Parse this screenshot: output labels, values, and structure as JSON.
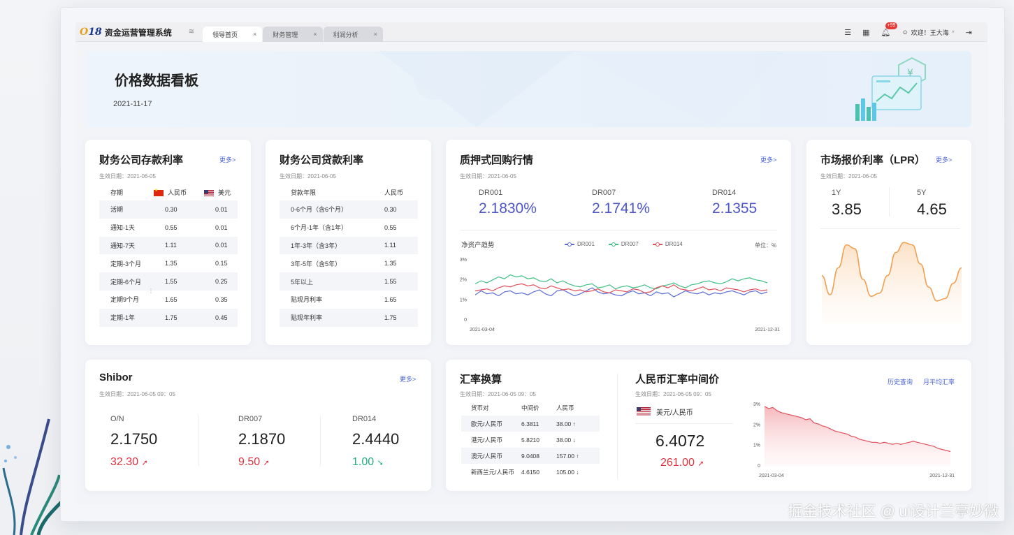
{
  "app": {
    "logo_mark": "18",
    "title": "资金运营管理系统",
    "tabs": [
      {
        "label": "领导首页",
        "close": "×"
      },
      {
        "label": "财务管理",
        "close": "×"
      },
      {
        "label": "利润分析",
        "close": "×"
      }
    ],
    "notification_badge": "+99",
    "welcome": "欢迎！王大海",
    "user_caret": "˅"
  },
  "banner": {
    "title": "价格数据看板",
    "date": "2021-11-17"
  },
  "deposit": {
    "title": "财务公司存款利率",
    "more": "更多>",
    "effective": "生效日期：2021-06-05",
    "headers": [
      "存期",
      "人民币",
      "美元"
    ],
    "rows": [
      [
        "活期",
        "0.30",
        "0.01"
      ],
      [
        "通知-1天",
        "0.55",
        "0.01"
      ],
      [
        "通知-7天",
        "1.11",
        "0.01"
      ],
      [
        "定期-3个月",
        "1.35",
        "0.15"
      ],
      [
        "定期-6个月",
        "1.55",
        "0.25"
      ],
      [
        "定期9个月",
        "1.65",
        "0.35"
      ],
      [
        "定期-1年",
        "1.75",
        "0.45"
      ]
    ]
  },
  "loan": {
    "title": "财务公司贷款利率",
    "effective": "生效日期：2021-06-05",
    "headers": [
      "贷款年限",
      "人民币"
    ],
    "rows": [
      [
        "0-6个月（含6个月）",
        "0.30"
      ],
      [
        "6个月-1年（含1年）",
        "0.55"
      ],
      [
        "1年-3年（含3年）",
        "1.11"
      ],
      [
        "3年-5年（含5年）",
        "1.35"
      ],
      [
        "5年以上",
        "1.55"
      ],
      [
        "贴现月利率",
        "1.65"
      ],
      [
        "贴现年利率",
        "1.75"
      ]
    ]
  },
  "repo": {
    "title": "质押式回购行情",
    "more": "更多>",
    "effective": "生效日期：2021-06-05",
    "items": [
      {
        "label": "DR001",
        "value": "2.1830%"
      },
      {
        "label": "DR007",
        "value": "2.1741%"
      },
      {
        "label": "DR014",
        "value": "2.1355"
      }
    ],
    "chart_title": "净资产趋势",
    "unit": "单位：%"
  },
  "lpr": {
    "title": "市场报价利率（LPR）",
    "more": "更多>",
    "effective": "生效日期：2021-06-05",
    "items": [
      {
        "label": "1Y",
        "value": "3.85"
      },
      {
        "label": "5Y",
        "value": "4.65"
      }
    ]
  },
  "shibor": {
    "title": "Shibor",
    "more": "更多>",
    "effective": "生效日期：2021-06-05  09：05",
    "items": [
      {
        "label": "O/N",
        "value": "2.1750",
        "change": "32.30",
        "arrow": "➚"
      },
      {
        "label": "DR007",
        "value": "2.1870",
        "change": "9.50",
        "arrow": "➚"
      },
      {
        "label": "DR014",
        "value": "2.4440",
        "change": "1.00",
        "arrow": "➘"
      }
    ]
  },
  "fx": {
    "title": "汇率换算",
    "effective": "生效日期：2021-06-05  09：05",
    "headers": [
      "货币对",
      "中间价",
      "人民币"
    ],
    "rows": [
      [
        "欧元/人民币",
        "6.3811",
        "38.00 ↑"
      ],
      [
        "港元/人民币",
        "5.8210",
        "38.00 ↓"
      ],
      [
        "澳元/人民币",
        "9.0408",
        "157.00 ↑"
      ],
      [
        "新西兰元/人民币",
        "4.6150",
        "105.00 ↓"
      ]
    ]
  },
  "cny_mid": {
    "title": "人民币汇率中间价",
    "effective": "生效日期：2021-06-05  09：05",
    "history_link": "历史查询",
    "avg_link": "月平均汇率",
    "pair": "美元/人民币",
    "value": "6.4072",
    "change": "261.00",
    "arrow": "➚"
  },
  "watermark": "掘金技术社区 @ ui设计兰亭妙微",
  "colors": {
    "accent": "#4d55c9",
    "up": "#e0323e",
    "down": "#23b07d",
    "link": "#4a64d8"
  },
  "chart_data": [
    {
      "type": "line",
      "title": "净资产趋势",
      "ylabel": "单位：%",
      "ylim": [
        0,
        3
      ],
      "yticks": [
        "3%",
        "2%",
        "1%",
        "0"
      ],
      "x_start": "2021-03-04",
      "x_end": "2021-12-31",
      "series": [
        {
          "name": "DR001",
          "color": "#5b6ad8",
          "values": [
            1.25,
            1.45,
            1.3,
            1.35,
            1.2,
            1.4,
            1.45,
            1.3,
            1.35,
            1.25,
            1.4,
            1.5,
            1.3,
            1.2,
            1.45,
            1.5,
            1.35,
            1.2,
            1.3,
            1.45,
            1.6,
            1.4,
            1.3,
            1.35,
            1.25,
            1.2,
            1.35,
            1.45,
            1.3,
            1.35,
            1.2,
            1.4,
            1.3,
            1.35,
            1.15,
            1.3,
            1.45,
            1.35,
            1.3,
            1.4,
            1.25,
            1.35,
            1.3,
            1.4,
            1.45,
            1.35,
            1.25,
            1.4,
            1.45,
            1.3,
            1.4
          ]
        },
        {
          "name": "DR007",
          "color": "#3fbf83",
          "values": [
            1.8,
            1.95,
            1.85,
            2.0,
            2.15,
            2.05,
            2.25,
            2.15,
            2.2,
            2.05,
            2.1,
            1.95,
            1.9,
            2.05,
            1.85,
            1.95,
            1.8,
            1.7,
            1.65,
            1.75,
            1.8,
            1.6,
            1.65,
            1.75,
            1.55,
            1.65,
            1.7,
            1.6,
            1.65,
            1.75,
            1.6,
            1.55,
            1.7,
            1.75,
            1.85,
            1.7,
            1.6,
            1.75,
            1.8,
            1.9,
            1.95,
            1.85,
            1.8,
            1.9,
            2.05,
            1.95,
            2.05,
            2.1,
            2.0,
            1.95,
            1.85
          ]
        },
        {
          "name": "DR014",
          "color": "#e0505a",
          "values": [
            1.45,
            1.5,
            1.55,
            1.45,
            1.6,
            1.7,
            1.65,
            1.75,
            1.8,
            1.7,
            1.75,
            1.6,
            1.55,
            1.7,
            1.6,
            1.5,
            1.55,
            1.45,
            1.5,
            1.4,
            1.45,
            1.55,
            1.4,
            1.35,
            1.5,
            1.45,
            1.4,
            1.55,
            1.5,
            1.35,
            1.4,
            1.6,
            1.7,
            1.6,
            1.75,
            1.55,
            1.5,
            1.45,
            1.55,
            1.65,
            1.5,
            1.55,
            1.45,
            1.6,
            1.55,
            1.5,
            1.4,
            1.5,
            1.55,
            1.45,
            1.5
          ]
        }
      ]
    },
    {
      "type": "line",
      "title": "",
      "series": [
        {
          "name": "",
          "color": "#f0a050",
          "values": [
            0.55,
            0.3,
            0.65,
            0.95,
            0.9,
            0.5,
            0.28,
            0.32,
            0.55,
            0.85,
            0.98,
            0.95,
            0.7,
            0.4,
            0.22,
            0.25,
            0.45,
            0.65
          ]
        }
      ]
    },
    {
      "type": "area",
      "title": "",
      "ylim": [
        0,
        3
      ],
      "yticks": [
        "3%",
        "2%",
        "1%",
        "0"
      ],
      "x_start": "2021-03-04",
      "x_end": "2021-12-31",
      "series": [
        {
          "name": "",
          "color": "#e0505a",
          "values": [
            2.9,
            2.8,
            2.85,
            2.7,
            2.6,
            2.55,
            2.5,
            2.45,
            2.4,
            2.35,
            2.25,
            2.3,
            2.1,
            2.05,
            1.95,
            1.9,
            1.8,
            1.7,
            1.65,
            1.6,
            1.55,
            1.45,
            1.4,
            1.3,
            1.25,
            1.2,
            1.15,
            1.15,
            1.1,
            1.15,
            1.1,
            1.05,
            1.1,
            1.05,
            1.1,
            1.15,
            1.2,
            1.15,
            1.1,
            1.05,
            1.0,
            0.95,
            0.85,
            0.8,
            0.75,
            0.7
          ]
        }
      ]
    }
  ]
}
